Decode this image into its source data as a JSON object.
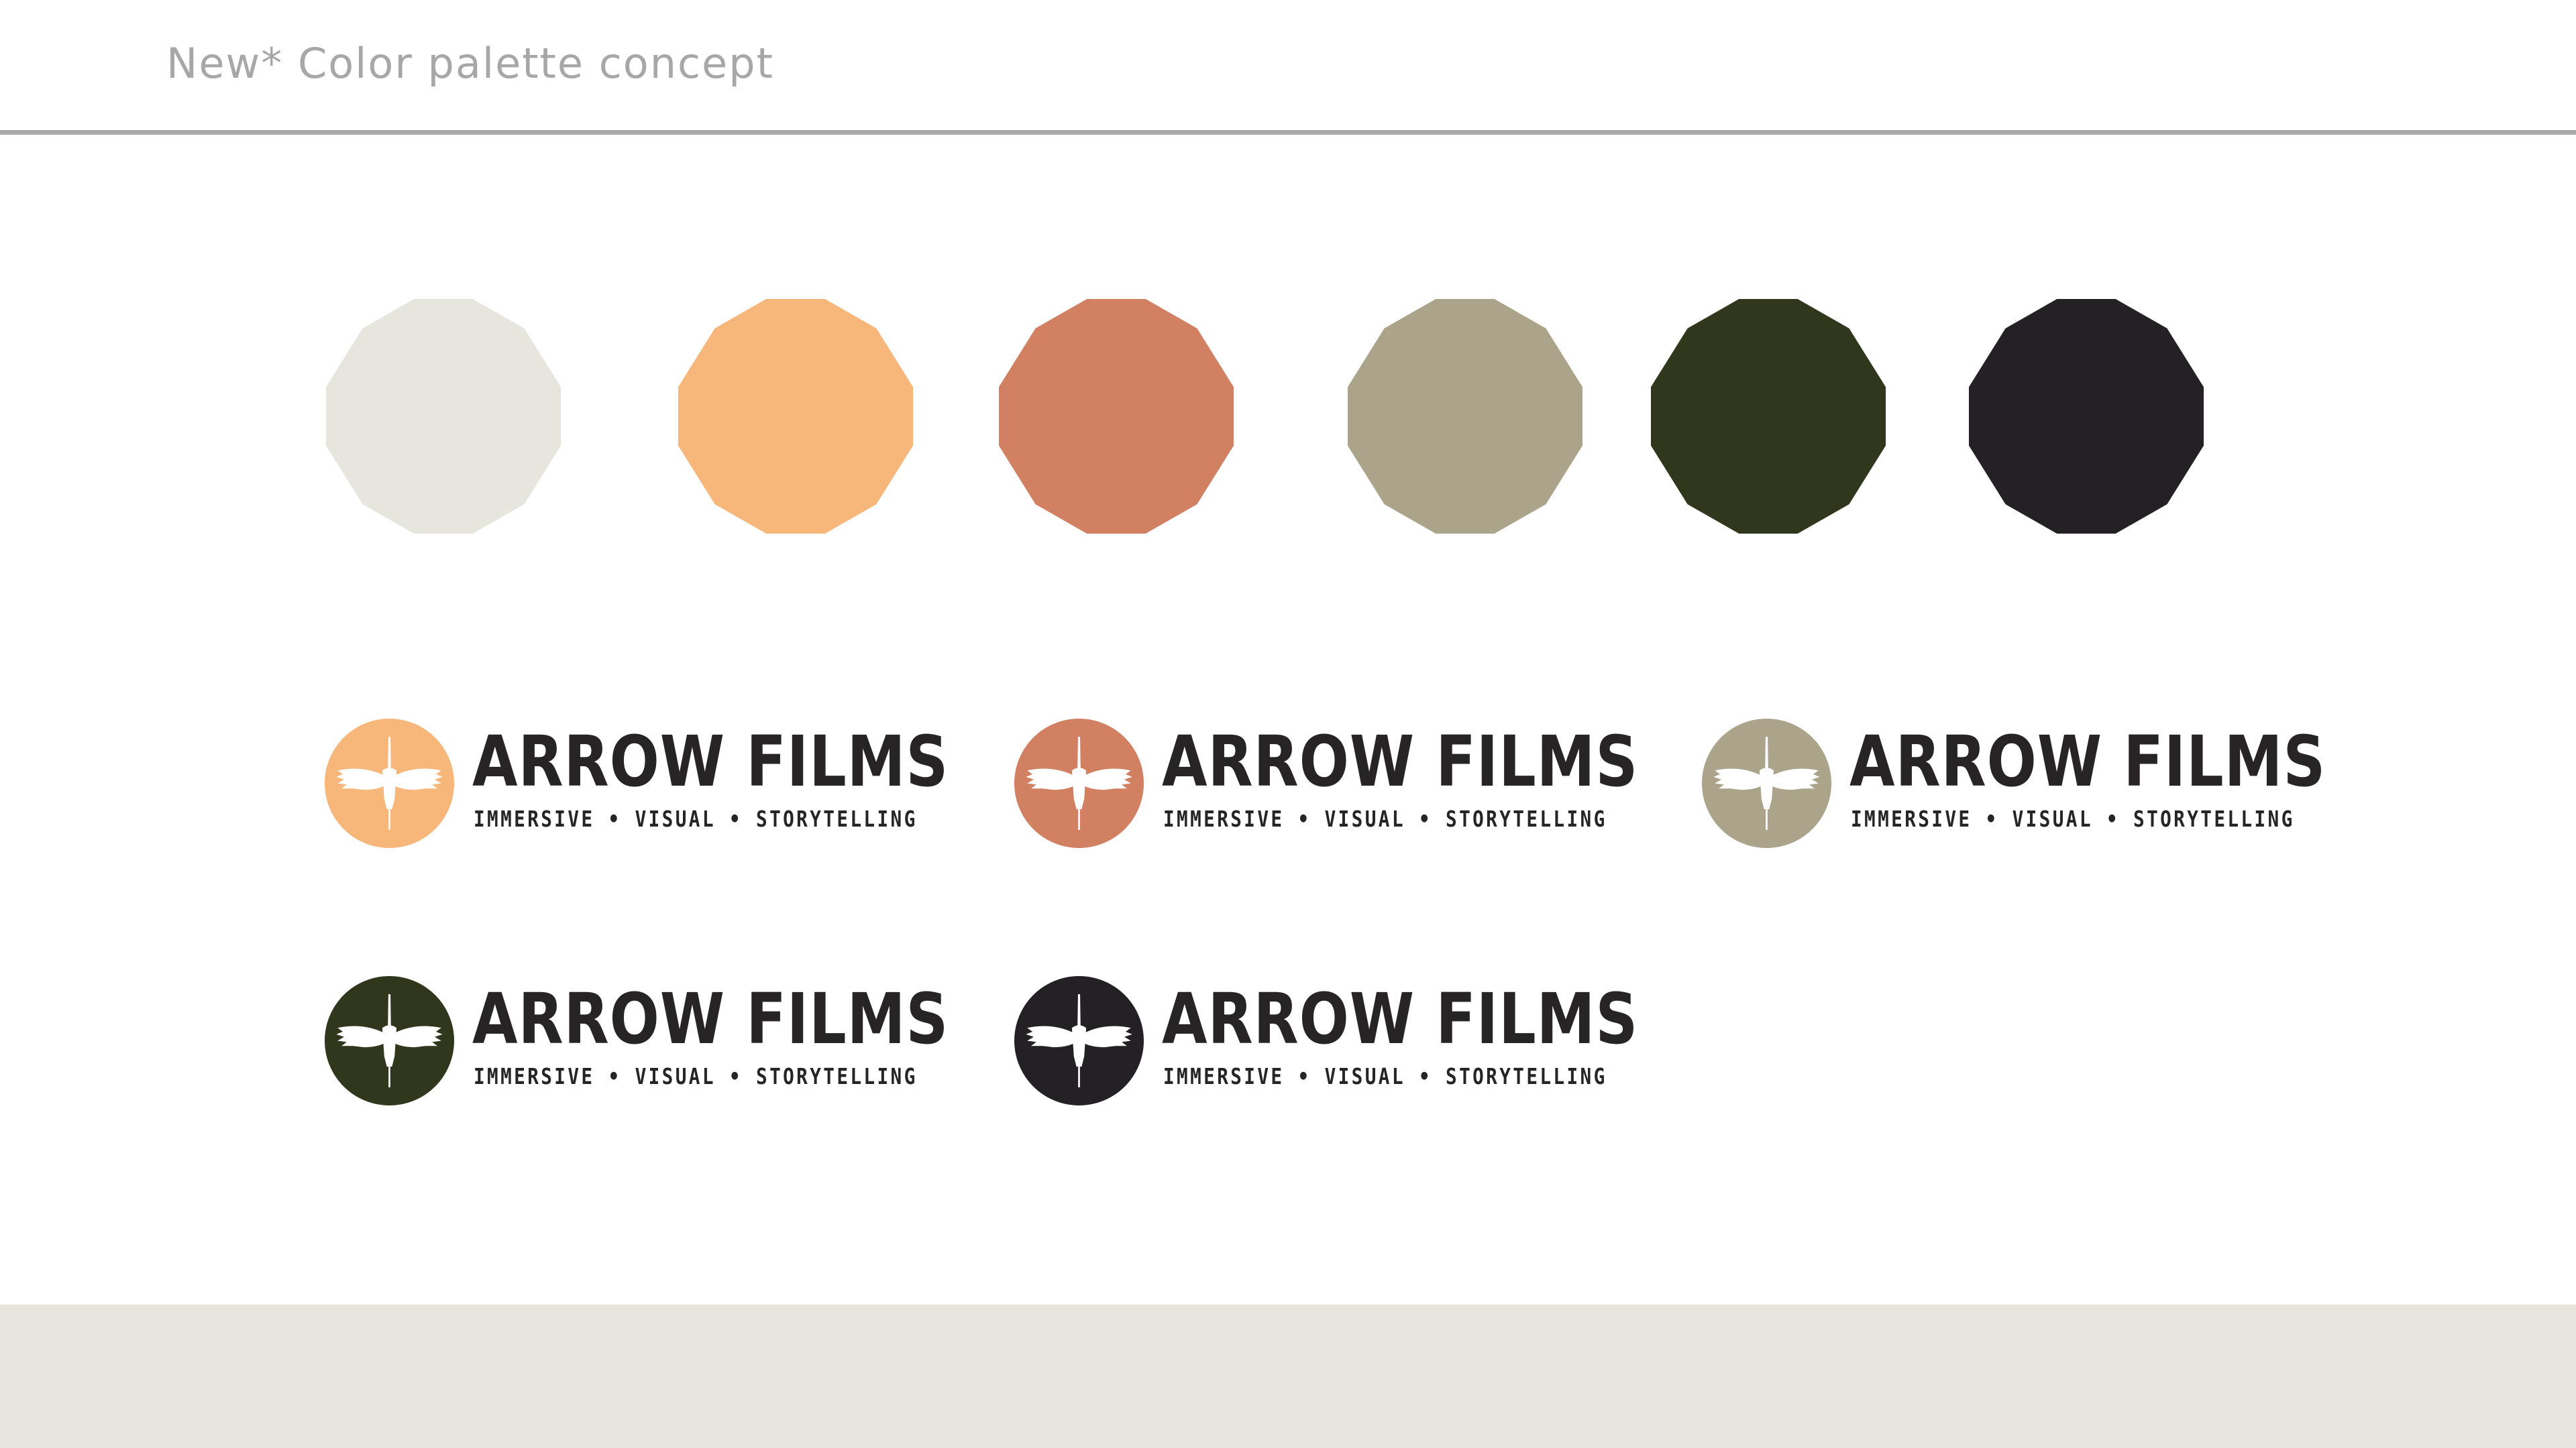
{
  "header": {
    "title": "New* Color palette concept"
  },
  "palette": {
    "colors": [
      "#e6e6df",
      "#f7b77b",
      "#d18062",
      "#aba48b",
      "#31371c",
      "#232123"
    ]
  },
  "brand": {
    "name": "ARROW FILMS",
    "tagline": "IMMERSIVE • VISUAL • STORYTELLING",
    "mark_icon": "flying-crane-icon",
    "variants": [
      {
        "color": "#f7b77b"
      },
      {
        "color": "#d18062"
      },
      {
        "color": "#aba48b"
      },
      {
        "color": "#31371c"
      },
      {
        "color": "#232123"
      }
    ]
  }
}
